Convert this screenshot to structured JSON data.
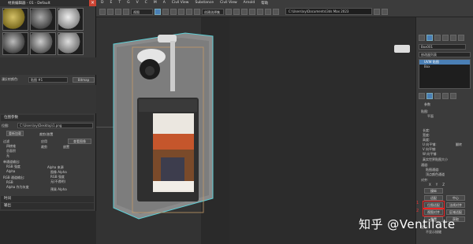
{
  "menubar": {
    "items": [
      "D",
      "E",
      "T",
      "G",
      "V",
      "C",
      "M",
      "A",
      "Civil View",
      "Substance",
      "Civil View",
      "Arnold",
      "帮助"
    ]
  },
  "toolbar": {
    "view_dropdown": "视图",
    "selection_dropdown": "创建选择集",
    "path": "C:\\Users\\xy\\Documents\\3ds Max 2023"
  },
  "material_editor": {
    "title": "材质编辑器 - 01 - Default",
    "slot_count": 6,
    "section_label": "漫反射颜色:",
    "map_name": "贴图 #1",
    "map_type": "Bitmap",
    "bitmap_rollout": "位图参数",
    "bitmap_label": "位图:",
    "bitmap_path": "C:\\Users\\xy\\Desktop\\1.png",
    "reload": "重新加载",
    "filter_label": "过滤",
    "filter_options": [
      "四棱锥",
      "总面积",
      "无"
    ],
    "crop_label": "裁剪/放置",
    "apply": "应用",
    "view_image": "查看图像",
    "crop": "裁剪",
    "place": "放置",
    "mono_label": "单通道输出:",
    "rgb_intensity": "RGB 强度",
    "alpha": "Alpha",
    "rgb_channel": "RGB 通道输出:",
    "rgb": "RGB",
    "alpha_as_gray": "Alpha 作为灰度",
    "alpha_source": "Alpha 来源",
    "image_alpha": "图像 Alpha",
    "rgb_intensity2": "RGB 强度",
    "none_opaque": "无(不透明)",
    "premultiplied": "预乘 Alpha",
    "rollout_time": "时间",
    "rollout_output": "输出"
  },
  "right_panel": {
    "object_name": "Box001",
    "modifier_list": "修改器列表",
    "stack_items": [
      "UVW 贴图",
      "Box"
    ],
    "params": "参数",
    "mapping_label": "贴图:",
    "planar": "平面",
    "length": "长度:",
    "width": "宽度:",
    "height": "高度:",
    "u_tile": "U 向平铺:",
    "v_tile": "V 向平铺:",
    "w_tile": "W 向平铺:",
    "flip": "翻转",
    "real_world": "真实世界贴图大小",
    "channel": "通道:",
    "map_channel": "贴图通道:",
    "vertex_color": "顶点颜色通道",
    "alignment": "对齐:",
    "xyz": [
      "X",
      "Y",
      "Z"
    ],
    "manipulate": "操纵",
    "fit": "适配",
    "center": "中心",
    "bitmap_fit": "位图适配",
    "normal_align": "法线对齐",
    "view_align": "视图对齐",
    "region_fit": "区域适配",
    "reset": "重置",
    "acquire": "获取",
    "display": "显示:",
    "no_seams": "不显示接缝",
    "highlight1": "1",
    "highlight2": "2"
  },
  "watermark": "知乎 @Ventilate",
  "colors": {
    "accent": "#4a7fb5",
    "highlight": "#e22222",
    "selection": "#5ecfd6"
  }
}
